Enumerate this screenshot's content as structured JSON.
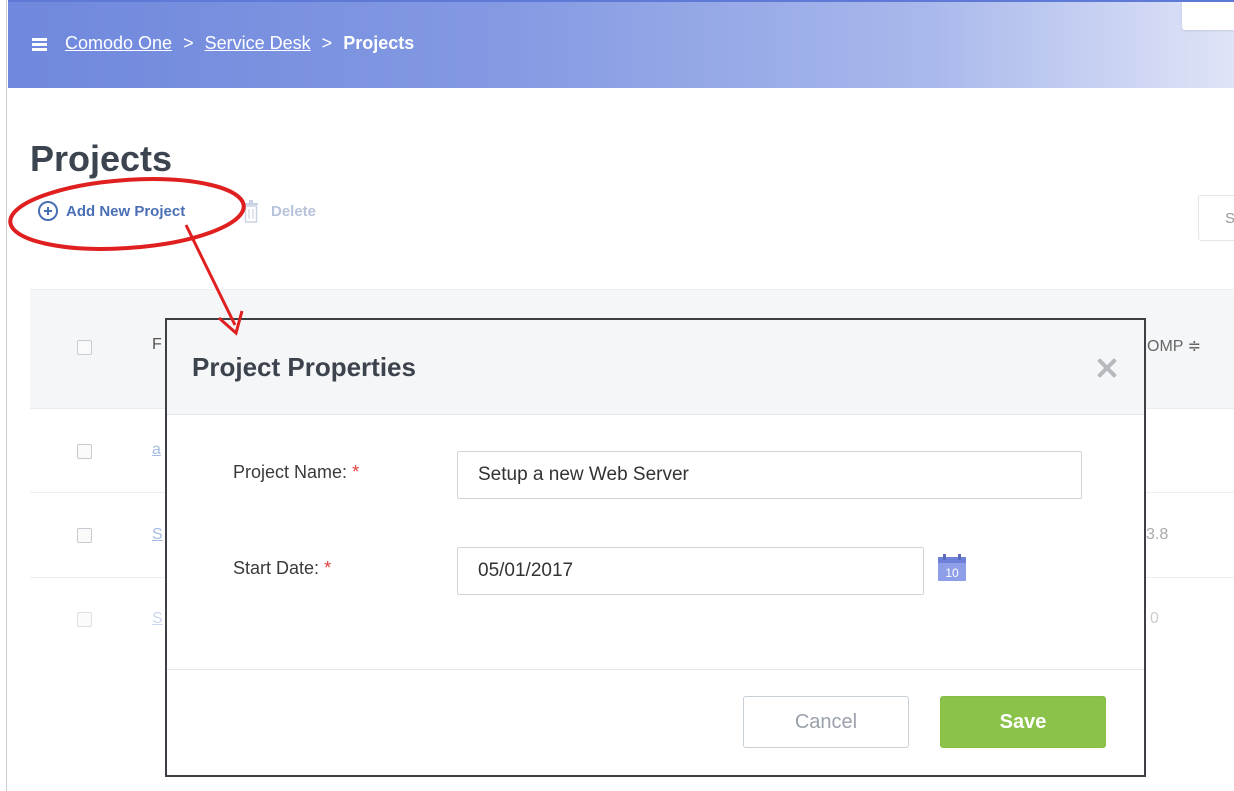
{
  "breadcrumb": {
    "items": [
      "Comodo One",
      "Service Desk"
    ],
    "separator": ">",
    "current": "Projects"
  },
  "page": {
    "title": "Projects"
  },
  "toolbar": {
    "add_label": "Add New Project",
    "delete_label": "Delete"
  },
  "search": {
    "value": "S"
  },
  "table": {
    "header_first_fragment": "F",
    "header_last_fragment": "OMP ≑",
    "rows": [
      {
        "name_fragment": "a",
        "value_fragment": ""
      },
      {
        "name_fragment": "S",
        "value_fragment": "3.8"
      },
      {
        "name_fragment": "S",
        "value_fragment": "0"
      }
    ]
  },
  "modal": {
    "title": "Project Properties",
    "fields": {
      "project_name_label": "Project Name:",
      "project_name_value": "Setup a new Web Server",
      "start_date_label": "Start Date:",
      "start_date_value": "05/01/2017",
      "required_mark": "*",
      "calendar_day": "10"
    },
    "cancel_label": "Cancel",
    "save_label": "Save"
  },
  "colors": {
    "header_gradient_start": "#7088dd",
    "accent_link": "#4a6fb4",
    "save_green": "#8bc34a",
    "annotation_red": "#e02020"
  },
  "icons": [
    "hamburger-icon",
    "plus-circle-icon",
    "trash-icon",
    "close-icon",
    "calendar-icon"
  ]
}
